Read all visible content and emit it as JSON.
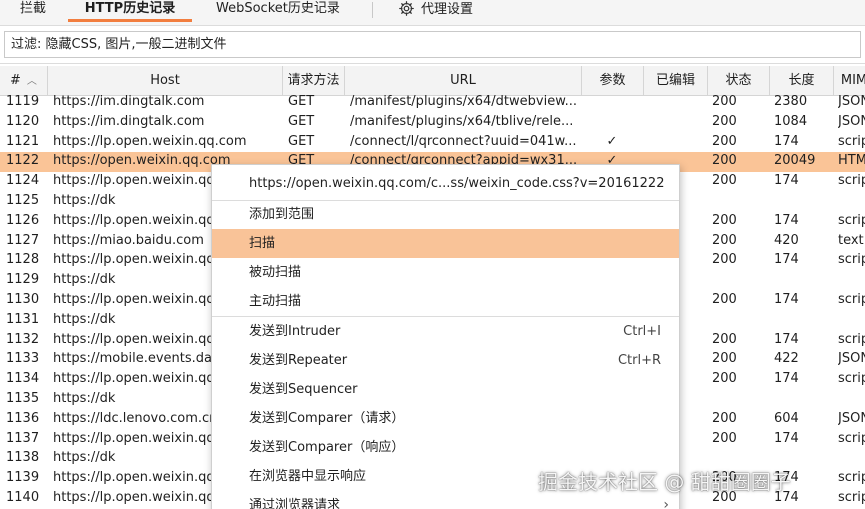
{
  "tabs": {
    "intercept": "拦截",
    "http_history": "HTTP历史记录",
    "websocket_history": "WebSocket历史记录",
    "proxy_settings": "代理设置"
  },
  "filter": {
    "text": "过滤: 隐藏CSS, 图片,一般二进制文件"
  },
  "columns": {
    "num": "#",
    "host": "Host",
    "method": "请求方法",
    "url": "URL",
    "params": "参数",
    "edited": "已编辑",
    "status": "状态",
    "length": "长度",
    "mime": "MIM"
  },
  "rows": [
    {
      "num": "1119",
      "host": "https://im.dingtalk.com",
      "method": "GET",
      "url": "/manifest/plugins/x64/dtwebview...",
      "params": "",
      "status": "200",
      "length": "2380",
      "mime": "JSON"
    },
    {
      "num": "1120",
      "host": "https://im.dingtalk.com",
      "method": "GET",
      "url": "/manifest/plugins/x64/tblive/rele...",
      "params": "",
      "status": "200",
      "length": "1084",
      "mime": "JSON"
    },
    {
      "num": "1121",
      "host": "https://lp.open.weixin.qq.com",
      "method": "GET",
      "url": "/connect/l/qrconnect?uuid=041w...",
      "params": "✓",
      "status": "200",
      "length": "174",
      "mime": "scrip"
    },
    {
      "num": "1122",
      "host": "https://open.weixin.qq.com",
      "method": "GET",
      "url": "/connect/qrconnect?appid=wx31...",
      "params": "✓",
      "status": "200",
      "length": "20049",
      "mime": "HTM"
    },
    {
      "num": "1124",
      "host": "https://lp.open.weixin.qq",
      "method": "",
      "url": "",
      "params": "",
      "status": "200",
      "length": "174",
      "mime": "scrip"
    },
    {
      "num": "1125",
      "host": "https://dk",
      "method": "",
      "url": "",
      "params": "",
      "status": "",
      "length": "",
      "mime": ""
    },
    {
      "num": "1126",
      "host": "https://lp.open.weixin.qq",
      "method": "",
      "url": "",
      "params": "",
      "status": "200",
      "length": "174",
      "mime": "scrip"
    },
    {
      "num": "1127",
      "host": "https://miao.baidu.com",
      "method": "",
      "url": "",
      "params": "",
      "status": "200",
      "length": "420",
      "mime": "text"
    },
    {
      "num": "1128",
      "host": "https://lp.open.weixin.qq",
      "method": "",
      "url": "",
      "params": "",
      "status": "200",
      "length": "174",
      "mime": "scrip"
    },
    {
      "num": "1129",
      "host": "https://dk",
      "method": "",
      "url": "",
      "params": "",
      "status": "",
      "length": "",
      "mime": ""
    },
    {
      "num": "1130",
      "host": "https://lp.open.weixin.qq",
      "method": "",
      "url": "",
      "params": "",
      "status": "200",
      "length": "174",
      "mime": "scrip"
    },
    {
      "num": "1131",
      "host": "https://dk",
      "method": "",
      "url": "",
      "params": "",
      "status": "",
      "length": "",
      "mime": ""
    },
    {
      "num": "1132",
      "host": "https://lp.open.weixin.qq",
      "method": "",
      "url": "",
      "params": "",
      "status": "200",
      "length": "174",
      "mime": "scrip"
    },
    {
      "num": "1133",
      "host": "https://mobile.events.da",
      "method": "",
      "url": "",
      "params": "",
      "status": "200",
      "length": "422",
      "mime": "JSON"
    },
    {
      "num": "1134",
      "host": "https://lp.open.weixin.qq",
      "method": "",
      "url": "",
      "params": "",
      "status": "200",
      "length": "174",
      "mime": "scrip"
    },
    {
      "num": "1135",
      "host": "https://dk",
      "method": "",
      "url": "",
      "params": "",
      "status": "",
      "length": "",
      "mime": ""
    },
    {
      "num": "1136",
      "host": "https://ldc.lenovo.com.cr",
      "method": "",
      "url": "",
      "params": "",
      "status": "200",
      "length": "604",
      "mime": "JSON"
    },
    {
      "num": "1137",
      "host": "https://lp.open.weixin.qq",
      "method": "",
      "url": "",
      "params": "",
      "status": "200",
      "length": "174",
      "mime": "scrip"
    },
    {
      "num": "1138",
      "host": "https://dk",
      "method": "",
      "url": "",
      "params": "",
      "status": "",
      "length": "",
      "mime": ""
    },
    {
      "num": "1139",
      "host": "https://lp.open.weixin.qq",
      "method": "",
      "url": "",
      "params": "",
      "status": "200",
      "length": "174",
      "mime": "scrip"
    },
    {
      "num": "1140",
      "host": "https://lp.open.weixin.qq",
      "method": "",
      "url": "",
      "params": "",
      "status": "200",
      "length": "174",
      "mime": "scrip"
    }
  ],
  "context_menu": {
    "url": "https://open.weixin.qq.com/c...ss/weixin_code.css?v=20161222",
    "add_to_scope": "添加到范围",
    "scan": "扫描",
    "passive_scan": "被动扫描",
    "active_scan": "主动扫描",
    "send_intruder": "发送到Intruder",
    "send_intruder_sc": "Ctrl+I",
    "send_repeater": "发送到Repeater",
    "send_repeater_sc": "Ctrl+R",
    "send_sequencer": "发送到Sequencer",
    "send_comparer_req": "发送到Comparer（请求）",
    "send_comparer_resp": "发送到Comparer（响应）",
    "show_in_browser": "在浏览器中显示响应",
    "request_in_browser": "通过浏览器请求"
  },
  "watermark": "掘金技术社区 @ 甜甜圈圈子",
  "colors": {
    "accent": "#f27e3f",
    "selected_row": "#fac497",
    "menu_highlight": "#f9c398"
  }
}
